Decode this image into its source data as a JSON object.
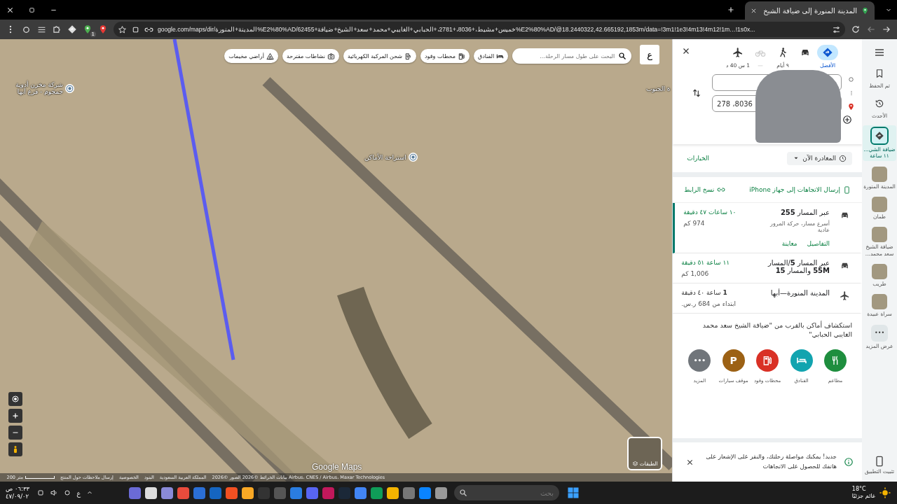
{
  "browser": {
    "tab": {
      "title": "المدينة المنورة إلى ضيافة الشيخ",
      "selected": true
    },
    "address_bar": {
      "url": "google.com/maps/dir/المدينة+المنورة%E2%80%AD/62455+خميس+مشيط،+8036،+2781،+الحبابي+الغايبي+محمد+سعد+الشيخ+ضيافة%E2%80%AD/@18.2440322,42.665192,1853m/data=!3m1!1e3!4m13!4m12!1m…!1s0x..."
    },
    "extension_badge": "1"
  },
  "map": {
    "search": {
      "placeholder": "البحث على طول مسار الرحلة..."
    },
    "chips": [
      {
        "label": "الفنادق",
        "kind": "hotel"
      },
      {
        "label": "محطات وقود",
        "kind": "gas"
      },
      {
        "label": "شحن المركبة الكهربائية",
        "kind": "ev"
      },
      {
        "label": "نشاطات مقترحة",
        "kind": "camera"
      },
      {
        "label": "أراضي مخيمات",
        "kind": "camp"
      }
    ],
    "language_button": "ع",
    "places": [
      {
        "label": "شركة مخزن أدوية جمجوم - فرع أبها",
        "kind": "pin"
      },
      {
        "label": "استراحة الأماكن",
        "kind": "pin"
      },
      {
        "label": "ة الجنوب",
        "kind": "text"
      }
    ],
    "logo": "Google Maps",
    "layers_label": "الطبقات",
    "attribution": [
      "بيانات الخرائط ©2026 الصور ©2026 Airbus، CNES / Airbus، Maxar Technologies",
      "المملكة العربية السعودية",
      "البنود",
      "الخصوصية",
      "إرسال ملاحظات حول المنتج"
    ],
    "scale": "200 متر"
  },
  "panel": {
    "modes": [
      {
        "kind": "best",
        "label": "الأفضل",
        "selected": true,
        "disabled": false
      },
      {
        "kind": "car",
        "selected": false,
        "disabled": false
      },
      {
        "kind": "walk",
        "label": "٩ أيام",
        "selected": false,
        "disabled": false
      },
      {
        "kind": "bike",
        "label": "—",
        "selected": false,
        "disabled": true
      },
      {
        "kind": "flight",
        "label": "1 س 40 د",
        "selected": false,
        "disabled": false
      }
    ],
    "destination": {
      "value": "8036، 278"
    },
    "depart": "المغادرة الآن",
    "options": "الخيارات",
    "send": "إرسال الاتجاهات إلى جهاز iPhone",
    "copy_link": "نسخ الرابط",
    "routes": [
      {
        "kind": "car",
        "title": "عبر المسار **255**",
        "duration": "١٠ ساعات ٤٧ دقيقة",
        "distance": "974 كم",
        "description": "أسرع مسار، حركة المرور عادية",
        "links": [
          "التفاصيل",
          "معاينة"
        ],
        "selected": true
      },
      {
        "kind": "car",
        "title": "عبر المسار **5**/المسار **55M** والمسار **15**",
        "duration": "١١ ساعة ٥١ دقيقة",
        "distance": "1,006 كم",
        "selected": false
      },
      {
        "kind": "flight",
        "title": "المدينة المنورة—أبها",
        "duration": "**1** ساعة ٤٠ دقيقة",
        "distance": "ابتداء من 684 ر.س.",
        "selected": false
      }
    ],
    "explore": {
      "title": "استكشاف أماكن بالقرب من \"ضيافة الشيخ سعد محمد الغايبي الحبابي\"",
      "categories": [
        {
          "kind": "restaurant",
          "label": "مطاعم",
          "color": "#1e8e3e"
        },
        {
          "kind": "hotel",
          "label": "الفنادق",
          "color": "#12a4af"
        },
        {
          "kind": "gas",
          "label": "محطات وقود",
          "color": "#d93025"
        },
        {
          "kind": "parking",
          "label": "موقف سيارات",
          "color": "#9c6114",
          "glyph": "P"
        },
        {
          "kind": "more",
          "label": "المزيد",
          "color": "#70757a",
          "glyph": "•••"
        }
      ]
    },
    "notice": "جديد! يمكنك مواصلة رحلتك، والنقر على الإشعار على هاتفك للحصول على الاتجاهات"
  },
  "rail": {
    "items": [
      {
        "kind": "saved",
        "label": "تم الحفظ",
        "selected": false
      },
      {
        "kind": "recent",
        "label": "الأحدث",
        "selected": false
      },
      {
        "kind": "directions",
        "label": "ضيافة الشي... ١١ ساعة",
        "selected": true
      },
      {
        "kind": "photo",
        "label": "المدينة المنورة",
        "selected": false
      },
      {
        "kind": "photo",
        "label": "طمان",
        "selected": false
      },
      {
        "kind": "photo",
        "label": "ضيافة الشيخ سعد محمد...",
        "selected": false
      },
      {
        "kind": "photo",
        "label": "طريب",
        "selected": false
      },
      {
        "kind": "photo",
        "label": "سراة عبيدة",
        "selected": false
      },
      {
        "kind": "more",
        "label": "عرض المزيد",
        "selected": false,
        "glyph": "•••"
      }
    ],
    "install": "تثبيت التطبيق"
  },
  "taskbar": {
    "time": "٠٦:٣٣ ص",
    "date": "٤٧/٠٩/٠٢",
    "language": "ع",
    "search": {
      "placeholder": "بحث"
    },
    "weather": {
      "temp": "18°C",
      "text": "غائم جزئيًا"
    }
  }
}
